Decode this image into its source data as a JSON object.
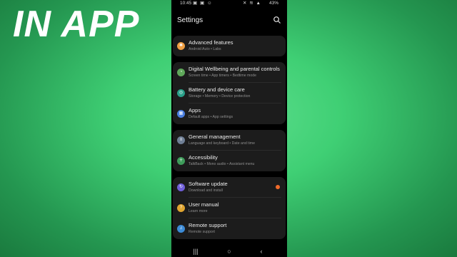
{
  "banner": {
    "text": "IN APP"
  },
  "status_bar": {
    "time": "10:45",
    "battery": "43%",
    "left_icons": "▣ ▣ ☺",
    "right_icons": "✕ ≋ ▲"
  },
  "header": {
    "title": "Settings"
  },
  "cards": [
    {
      "items": [
        {
          "label": "Advanced features",
          "sub": "Android Auto  •  Labs",
          "icon": "star-gear-icon",
          "color": "#f0a043"
        }
      ]
    },
    {
      "items": [
        {
          "label": "Digital Wellbeing and parental controls",
          "sub": "Screen time  •  App timers  •  Bedtime mode",
          "icon": "wellbeing-icon",
          "color": "#5fa85a"
        },
        {
          "label": "Battery and device care",
          "sub": "Storage  •  Memory  •  Device protection",
          "icon": "device-care-icon",
          "color": "#2aa18a"
        },
        {
          "label": "Apps",
          "sub": "Default apps  •  App settings",
          "icon": "apps-grid-icon",
          "color": "#4b7fe0"
        }
      ]
    },
    {
      "items": [
        {
          "label": "General management",
          "sub": "Language and keyboard  •  Date and time",
          "icon": "sliders-icon",
          "color": "#6f7f95"
        },
        {
          "label": "Accessibility",
          "sub": "TalkBack  •  Mono audio  •  Assistant menu",
          "icon": "accessibility-icon",
          "color": "#3e9c5a"
        }
      ]
    },
    {
      "items": [
        {
          "label": "Software update",
          "sub": "Download and install",
          "icon": "software-update-icon",
          "color": "#6f5ed8",
          "badge": true
        },
        {
          "label": "User manual",
          "sub": "Learn more",
          "icon": "manual-icon",
          "color": "#e0a530"
        },
        {
          "label": "Remote support",
          "sub": "Remote support",
          "icon": "remote-support-icon",
          "color": "#3c8bd6"
        }
      ]
    }
  ],
  "nav": {
    "recents": "|||",
    "home": "○",
    "back": "‹"
  }
}
